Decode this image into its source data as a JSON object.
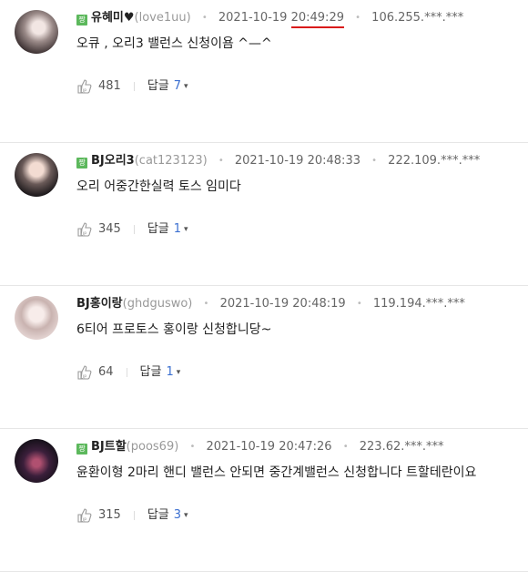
{
  "comments": [
    {
      "badge": "짱",
      "nickname": "유혜미♥",
      "user_id": "(love1uu)",
      "date": "2021-10-19",
      "time": "20:49:29",
      "ip": "106.255.***.***",
      "text": "오큐 , 오리3 밸런스 신청이욤 ^—^",
      "likes": "481",
      "reply_label": "답글",
      "reply_count": "7"
    },
    {
      "badge": "짱",
      "nickname": "BJ오리3",
      "user_id": "(cat123123)",
      "date": "2021-10-19",
      "time": "20:48:33",
      "ip": "222.109.***.***",
      "text": "오리 어중간한실력 토스 임미다",
      "likes": "345",
      "reply_label": "답글",
      "reply_count": "1"
    },
    {
      "badge": "",
      "nickname": "BJ홍이랑",
      "user_id": "(ghdguswo)",
      "date": "2021-10-19",
      "time": "20:48:19",
      "ip": "119.194.***.***",
      "text": "6티어 프로토스 홍이랑 신청합니당~",
      "likes": "64",
      "reply_label": "답글",
      "reply_count": "1"
    },
    {
      "badge": "짱",
      "nickname": "BJ트할",
      "user_id": "(poos69)",
      "date": "2021-10-19",
      "time": "20:47:26",
      "ip": "223.62.***.***",
      "text": "윤환이형 2마리 핸디 밸런스 안되면 중간계밸런스 신청합니다 트할테란이요",
      "likes": "315",
      "reply_label": "답글",
      "reply_count": "3"
    }
  ],
  "icons": {
    "like": "thumbs-up-icon",
    "expand": "chevron-down-icon"
  },
  "colors": {
    "badge": "#5cb85c",
    "reply_count": "#3b6fd0",
    "highlight_underline": "#d91a1a"
  }
}
